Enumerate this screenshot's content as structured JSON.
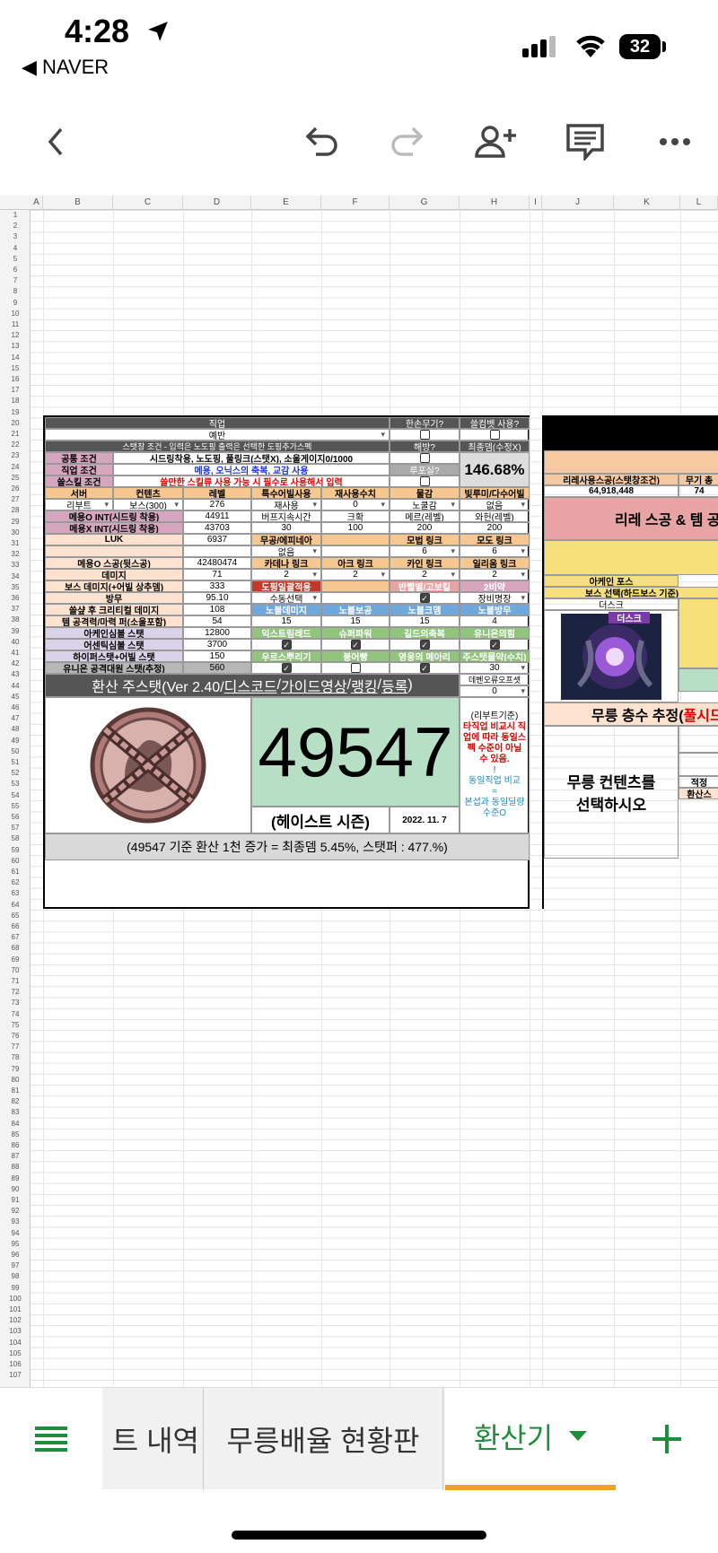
{
  "status": {
    "time": "4:28",
    "back_app": "◀ NAVER",
    "battery": "32"
  },
  "columns": [
    "A",
    "B",
    "C",
    "D",
    "E",
    "F",
    "G",
    "H",
    "I",
    "J",
    "K",
    "L"
  ],
  "header": {
    "job": "직업",
    "job_value": "예반",
    "one_hand": "한손무기?",
    "sol_erda": "쓸컴벳 사용?",
    "cond_note": "스탯창 조건 - 입력은 노도핑 출력은 선택한 도핑추가스펙",
    "haebang": "해방?",
    "final_dmg": "최종뎀(수정X)",
    "common_label": "공통 조건",
    "common_value": "시드링착용, 노도핑, 풀링크(스탯X), 소울게이지0/1000",
    "job_cond_label": "직업 조건",
    "job_cond_value": "메용, 오닉스의 축복, 교감 사용",
    "rupo": "루포실?",
    "final_pct": "146.68%",
    "skill_label": "쓸스킬 조건",
    "skill_value": "쓸만한 스킬류 사용 가능 시 필수로 사용해서 입력"
  },
  "row8": [
    "서버",
    "컨텐츠",
    "레벨",
    "특수어빌사용",
    "재사용수치",
    "물감",
    "빛루미/다수어빌"
  ],
  "row9": [
    "리부트",
    "보스(300)",
    "276",
    "재사용",
    "0",
    "노쿨감",
    "없음"
  ],
  "stats": [
    {
      "label": "메용O INT(시드링 착용)",
      "value": "44911",
      "a": "버프지속시간",
      "b": "크확",
      "c": "메르(레벨)",
      "d": "와헌(레벨)"
    },
    {
      "label": "메용X INT(시드링 착용)",
      "value": "43703",
      "a": "30",
      "b": "100",
      "c": "200",
      "d": "200"
    },
    {
      "label": "LUK",
      "value": "6937",
      "a": "무공/에피네아",
      "b": "",
      "c": "모법 링크",
      "d": "모도 링크"
    },
    {
      "label": "",
      "value": "",
      "a": "없음",
      "b": "",
      "c": "6",
      "d": "6"
    },
    {
      "label": "메용O 스공(뒷스공)",
      "value": "42480474",
      "a": "카데나 링크",
      "b": "아크 링크",
      "c": "카인 링크",
      "d": "일리움 링크"
    },
    {
      "label": "데미지",
      "value": "71",
      "a": "2",
      "b": "2",
      "c": "2",
      "d": "2"
    },
    {
      "label": "보스 데미지(+어빌 상추뎀)",
      "value": "333",
      "a": "도핑일괄적용",
      "b": "",
      "c": "반빨별/고보킬",
      "d": "2비약"
    },
    {
      "label": "방무",
      "value": "95.10",
      "a": "수동선택",
      "b": "",
      "c": "",
      "d": "장비명장"
    },
    {
      "label": "쓸샾 후 크리티컬 데미지",
      "value": "108",
      "a": "노블데미지",
      "b": "노블보공",
      "c": "노블크뎀",
      "d": "노블방무"
    },
    {
      "label": "템 공격력/마력 퍼(소울포함)",
      "value": "54",
      "a": "15",
      "b": "15",
      "c": "15",
      "d": "4"
    },
    {
      "label": "아케인심볼 스탯",
      "value": "12800",
      "a": "익스트림레드",
      "b": "슈퍼파워",
      "c": "길드의축복",
      "d": "유니온의힘"
    },
    {
      "label": "어센틱심볼 스탯",
      "value": "3700",
      "a": "",
      "b": "",
      "c": "",
      "d": ""
    },
    {
      "label": "하이퍼스탯+어빌 스탯",
      "value": "150",
      "a": "우르스뿌리기",
      "b": "붕어빵",
      "c": "영웅의 메아리",
      "d": "주스탯물약(수치)"
    },
    {
      "label": "유니온 공격대원 스탯(추정)",
      "value": "560",
      "a": "",
      "b": "",
      "c": "",
      "d": "30"
    }
  ],
  "result": {
    "title_prefix": "환산 주스탯(Ver 2.40/",
    "link1": "디스코드",
    "sep1": "/",
    "link2": "가이드영상",
    "sep2": "/",
    "link3": "랭킹",
    "sep3": "/",
    "link4": "등록",
    "suffix": ")",
    "offset_label": "데벤오류오프셋",
    "offset_value": "0",
    "score": "49547",
    "season": "(헤이스트 시즌)",
    "date": "2022. 11. 7",
    "note1": "(리부트기준)",
    "note2": "타직업 비교시 직업에 따라 동일스펙 수준이 아닐 수 있음.",
    "note3": "!",
    "note4": "동일직업 비교",
    "note5": "=",
    "note6": "본섭과 동일딜량 수준O",
    "footer": "(49547 기준 환산 1천 증가 = 최종뎀 5.45%, 스탯퍼 : 477.%)"
  },
  "right": {
    "r6a": "리레사용스공(스탯창조건)",
    "r6b": "무기 총",
    "r7a": "64,918,448",
    "r7b": "74",
    "banner": "리레 스공 & 템 공",
    "arcane": "아케인 포스",
    "boss_sel": "보스 선택(하드보스 기준)",
    "boss": "더스크",
    "boss_tag": "더스크",
    "mureung": "무릉 층수 추정(풀시드",
    "mureung_red": "풀시드",
    "select": "무릉 컨텐츠를 선택하시오",
    "r32": "적정",
    "r33": "환산스"
  },
  "tabs": {
    "t1": "트 내역",
    "t2": "무릉배율 현황판",
    "t3": "환산기"
  },
  "colors": {
    "accent_green": "#1e8e3e",
    "tab_underline": "#f0a030"
  }
}
